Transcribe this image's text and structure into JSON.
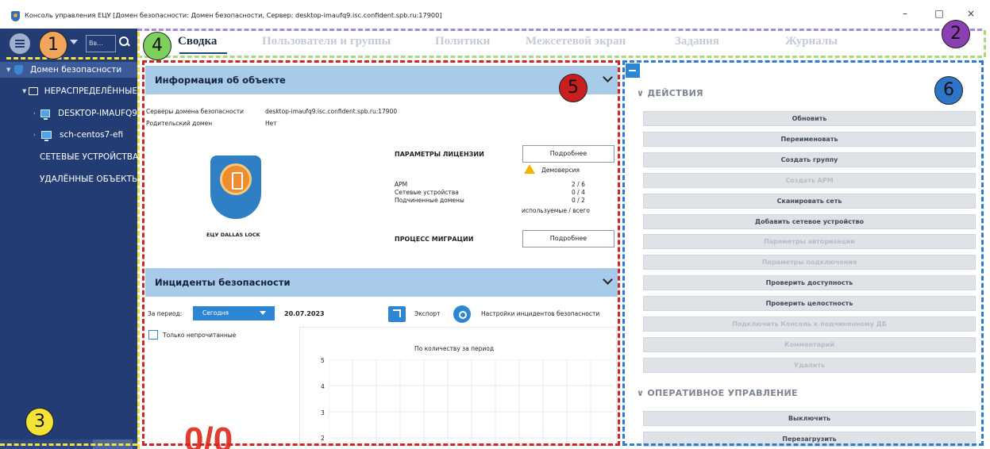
{
  "window": {
    "title": "Консоль управления ЕЦУ [Домен безопасности: Домен безопасности, Сервер: desktop-imaufq9.isc.confident.spb.ru:17900]",
    "controls": [
      "–",
      "□",
      "×"
    ]
  },
  "sidebar": {
    "search_value": "Вв...",
    "tree": [
      {
        "label": "Домен безопасности",
        "icon": "shield-icon"
      },
      {
        "label": "НЕРАСПРЕДЕЛЁННЫЕ",
        "icon": "folder-outline-icon"
      },
      {
        "label": "DESKTOP-IMAUFQ9",
        "icon": "monitor-icon"
      },
      {
        "label": "sch-centos7-efi",
        "icon": "monitor-icon"
      },
      {
        "label": "СЕТЕВЫЕ УСТРОЙСТВА",
        "icon": "folder-icon"
      },
      {
        "label": "УДАЛЁННЫЕ ОБЪЕКТЫ",
        "icon": "folder-icon"
      }
    ]
  },
  "annotations": {
    "badges": [
      "1",
      "2",
      "3",
      "4",
      "5",
      "6"
    ],
    "colors": {
      "badge1": "#f1a45c",
      "badge2": "#8a3fb2",
      "badge3": "#f5e236",
      "badge4": "#7fcf5c",
      "badge5": "#c91f1f",
      "badge6": "#2e74c7"
    }
  },
  "tabs": [
    "Сводка",
    "Пользователи и группы",
    "Политики",
    "Межсетевой экран",
    "Задания",
    "Журналы"
  ],
  "object_info": {
    "header": "Информация об объекте",
    "servers_label": "Серверы домена безопасности",
    "servers_value": "desktop-imaufq9.isc.confident.spb.ru:17900",
    "parent_label": "Родительский домен",
    "parent_value": "Нет",
    "logo_caption": "ЕЦУ DALLAS LOCK",
    "license_title": "ПАРАМЕТРЫ ЛИЦЕНЗИИ",
    "license_button": "Подробнее",
    "demo_label": "Демоверсия",
    "rows": [
      {
        "label": "АРМ",
        "value": "2 / 6"
      },
      {
        "label": "Сетевые устройства",
        "value": "0 / 4"
      },
      {
        "label": "Подчиненные домены",
        "value": "0 / 2"
      }
    ],
    "used_total": "используемые / всего",
    "migration_title": "ПРОЦЕСС МИГРАЦИИ",
    "migration_button": "Подробнее"
  },
  "incidents": {
    "header": "Инциденты безопасности",
    "period_label": "За период:",
    "period_value": "Сегодня",
    "date": "20.07.2023",
    "export_label": "Экспорт",
    "settings_label": "Настройки инцидентов безопасности",
    "unread_only_label": "Только непрочитанные",
    "unread_only_checked": false,
    "chart_title": "По количеству за период",
    "y_ticks": [
      "5",
      "4",
      "3",
      "2"
    ],
    "big_counter": "0/0"
  },
  "actions_panel": {
    "actions_heading": "ДЕЙСТВИЯ",
    "actions": [
      {
        "label": "Обновить",
        "enabled": true
      },
      {
        "label": "Переименовать",
        "enabled": true
      },
      {
        "label": "Создать группу",
        "enabled": true
      },
      {
        "label": "Создать АРМ",
        "enabled": false
      },
      {
        "label": "Сканировать сеть",
        "enabled": true
      },
      {
        "label": "Добавить сетевое устройство",
        "enabled": true
      },
      {
        "label": "Параметры авторизации",
        "enabled": false
      },
      {
        "label": "Параметры подключения",
        "enabled": false
      },
      {
        "label": "Проверить доступность",
        "enabled": true
      },
      {
        "label": "Проверить целостность",
        "enabled": true
      },
      {
        "label": "Подключить Консоль к подчиненному ДБ",
        "enabled": false
      },
      {
        "label": "Комментарий",
        "enabled": false
      },
      {
        "label": "Удалить",
        "enabled": false
      }
    ],
    "operational_heading": "ОПЕРАТИВНОЕ УПРАВЛЕНИЕ",
    "operational_actions": [
      {
        "label": "Выключить",
        "enabled": true
      },
      {
        "label": "Перезагрузить",
        "enabled": true
      }
    ]
  }
}
